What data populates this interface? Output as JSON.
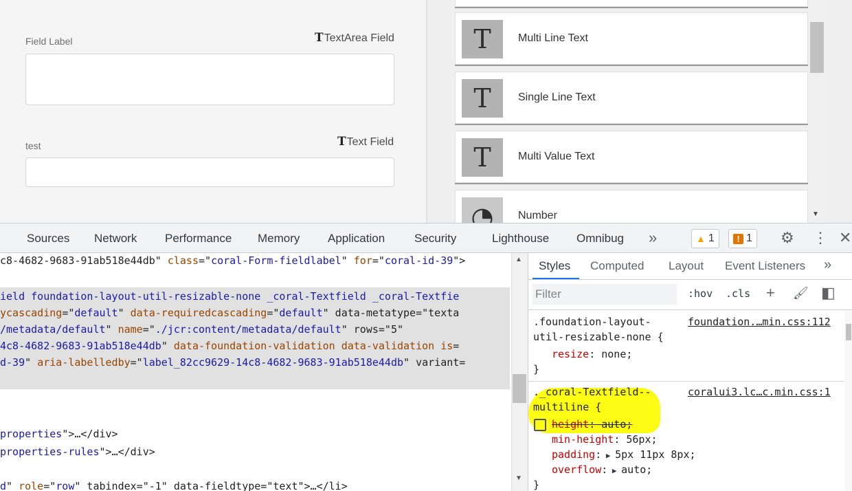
{
  "form": {
    "field1": {
      "label": "Field Label",
      "type_glyph": "T",
      "type_label": "TextArea Field",
      "value": ""
    },
    "field2": {
      "label": "test",
      "type_glyph": "T",
      "type_label": "Text Field",
      "value": ""
    }
  },
  "components": [
    {
      "glyph": "T",
      "label": "Multi Line Text"
    },
    {
      "glyph": "T",
      "label": "Single Line Text"
    },
    {
      "glyph": "T",
      "label": "Multi Value Text"
    },
    {
      "glyph": "◔",
      "label": "Number"
    }
  ],
  "devtools": {
    "tabs": [
      "Sources",
      "Network",
      "Performance",
      "Memory",
      "Application",
      "Security",
      "Lighthouse",
      "Omnibug"
    ],
    "more_tabs": "»",
    "warnings": {
      "icon": "▲",
      "count": "1"
    },
    "issues": {
      "icon": "!",
      "count": "1"
    },
    "settings_icon": "⚙",
    "menu_icon": "⋮",
    "close_icon": "✕"
  },
  "elements": {
    "lines": [
      {
        "p1": "c8-4682-9683-91ab518e44db\" ",
        "a1": "class",
        "e1": "=\"",
        "v1": "coral-Form-fieldlabel",
        "e2": "\" ",
        "a2": "for",
        "e3": "=\"",
        "v2": "coral-id-39",
        "e4": "\">"
      },
      {
        "p1": "",
        "a1": "",
        "e1": "",
        "v1": "",
        "e2": "",
        "a2": "",
        "e3": "",
        "v2": "",
        "e4": ""
      },
      {
        "p1": "",
        "a1": "",
        "e1": "",
        "v1": "ield foundation-layout-util-resizable-none _coral-Textfield _coral-Textfie",
        "e2": "",
        "a2": "",
        "e3": "",
        "v2": "",
        "e4": ""
      },
      {
        "p1": "",
        "a1": "ycascading",
        "e1": "=\"",
        "v1": "default",
        "e2": "\" ",
        "a2": "data-requiredcascading",
        "e3": "=\"",
        "v2": "default",
        "e4": "\" data-metatype=\"texta"
      },
      {
        "p1": "",
        "a1": "",
        "e1": "",
        "v1": "/metadata/default",
        "e2": "\" ",
        "a2": "name",
        "e3": "=\"",
        "v2": "./jcr:content/metadata/default",
        "e4": "\" rows=\"5\""
      },
      {
        "p1": "",
        "a1": "",
        "e1": "",
        "v1": "4c8-4682-9683-91ab518e44db",
        "e2": "\" ",
        "a2": "data-foundation-validation data-validation is",
        "e3": "=",
        "v2": "",
        "e4": ""
      },
      {
        "p1": "",
        "a1": "",
        "e1": "",
        "v1": "d-39",
        "e2": "\" ",
        "a2": "aria-labelledby",
        "e3": "=\"",
        "v2": "label_82cc9629-14c8-4682-9683-91ab518e44db",
        "e4": "\" variant="
      },
      {
        "p1": "",
        "a1": "",
        "e1": "",
        "v1": "",
        "e2": "",
        "a2": "",
        "e3": "",
        "v2": "",
        "e4": ""
      },
      {
        "p1": "",
        "a1": "",
        "e1": "",
        "v1": "",
        "e2": "",
        "a2": "",
        "e3": "",
        "v2": "",
        "e4": ""
      },
      {
        "p1": "",
        "a1": "",
        "e1": "",
        "v1": "properties",
        "e2": "\">",
        "a2": "",
        "e3": "…",
        "v2": "",
        "e4": "</div>"
      },
      {
        "p1": "",
        "a1": "",
        "e1": "",
        "v1": "properties-rules",
        "e2": "\">",
        "a2": "",
        "e3": "…",
        "v2": "",
        "e4": "</div>"
      },
      {
        "p1": "",
        "a1": "",
        "e1": "",
        "v1": "",
        "e2": "",
        "a2": "",
        "e3": "",
        "v2": "",
        "e4": ""
      },
      {
        "p1": "",
        "a1": "",
        "e1": "",
        "v1": "d",
        "e2": "\" ",
        "a2": "role",
        "e3": "=\"",
        "v2": "row",
        "e4": "\" tabindex=\"-1\" data-fieldtype=\"text\">…</li>"
      }
    ]
  },
  "styles": {
    "tabs": [
      "Styles",
      "Computed",
      "Layout",
      "Event Listeners"
    ],
    "more_tabs": "»",
    "filter_placeholder": "Filter",
    "hov_label": ":hov",
    "cls_label": ".cls",
    "plus_icon": "+",
    "paint_icon": "🖌",
    "sidebar_icon": "◧",
    "rule1": {
      "selector_line1": ".foundation-layout-",
      "selector_line2": "util-resizable-none {",
      "source": "foundation.…min.css:112",
      "prop": "resize",
      "value": "none",
      "close": "}"
    },
    "rule2": {
      "selector_line1": "._coral-Textfield--",
      "selector_line2": "multiline {",
      "source": "coralui3.lc…c.min.css:1",
      "decls": [
        {
          "prop": "height",
          "value": "auto",
          "disabled": true
        },
        {
          "prop": "min-height",
          "value": "56px",
          "disabled": false
        },
        {
          "prop": "padding",
          "value": "5px 11px 8px",
          "disabled": false
        },
        {
          "prop": "overflow",
          "value": "auto",
          "disabled": false
        }
      ],
      "close": "}"
    }
  }
}
